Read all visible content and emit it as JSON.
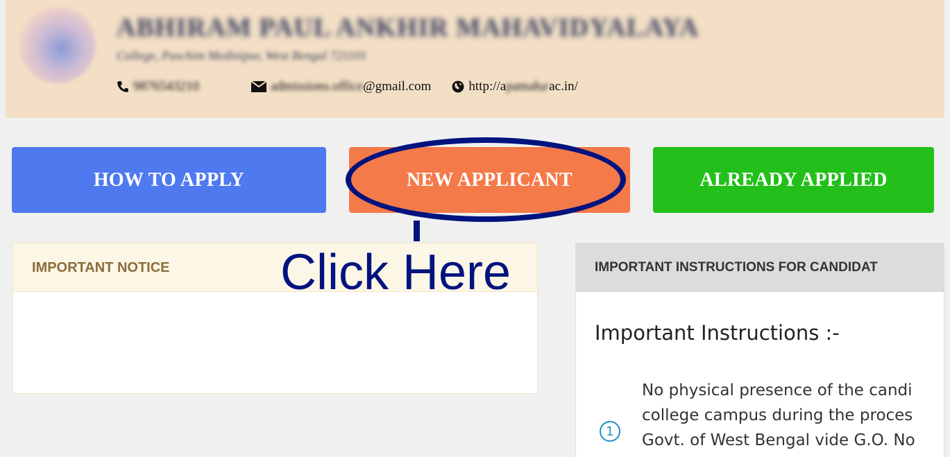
{
  "header": {
    "college_name": "ABHIRAM PAUL ANKHIR MAHAVIDYALAYA",
    "address": "College, Paschim Medinipur, West Bengal 721101",
    "phone": "9876543210",
    "email_prefix": "admissions.office",
    "email_suffix": "@gmail.com",
    "website_prefix": "http://a",
    "website_mask": "pamahavidyalaya",
    "website_suffix": "ac.in/"
  },
  "buttons": {
    "how_to_apply": "HOW TO APPLY",
    "new_applicant": "NEW APPLICANT",
    "already_applied": "ALREADY APPLIED"
  },
  "annotation": {
    "text": "Click Here",
    "color": "#00137e"
  },
  "notice": {
    "title": "IMPORTANT NOTICE"
  },
  "instructions": {
    "header": "IMPORTANT INSTRUCTIONS FOR CANDIDAT",
    "title": "Important Instructions :-",
    "item_number": "1",
    "line1": "No physical presence of the candi",
    "line2": "college campus during the proces",
    "line3": "Govt. of West Bengal vide G.O. No"
  },
  "colors": {
    "header_bg": "#f2dfc5",
    "how_to_apply": "#4f79ef",
    "new_applicant": "#f47a4a",
    "already_applied": "#23bf1b"
  },
  "icons": [
    "phone-icon",
    "envelope-icon",
    "globe-icon"
  ]
}
